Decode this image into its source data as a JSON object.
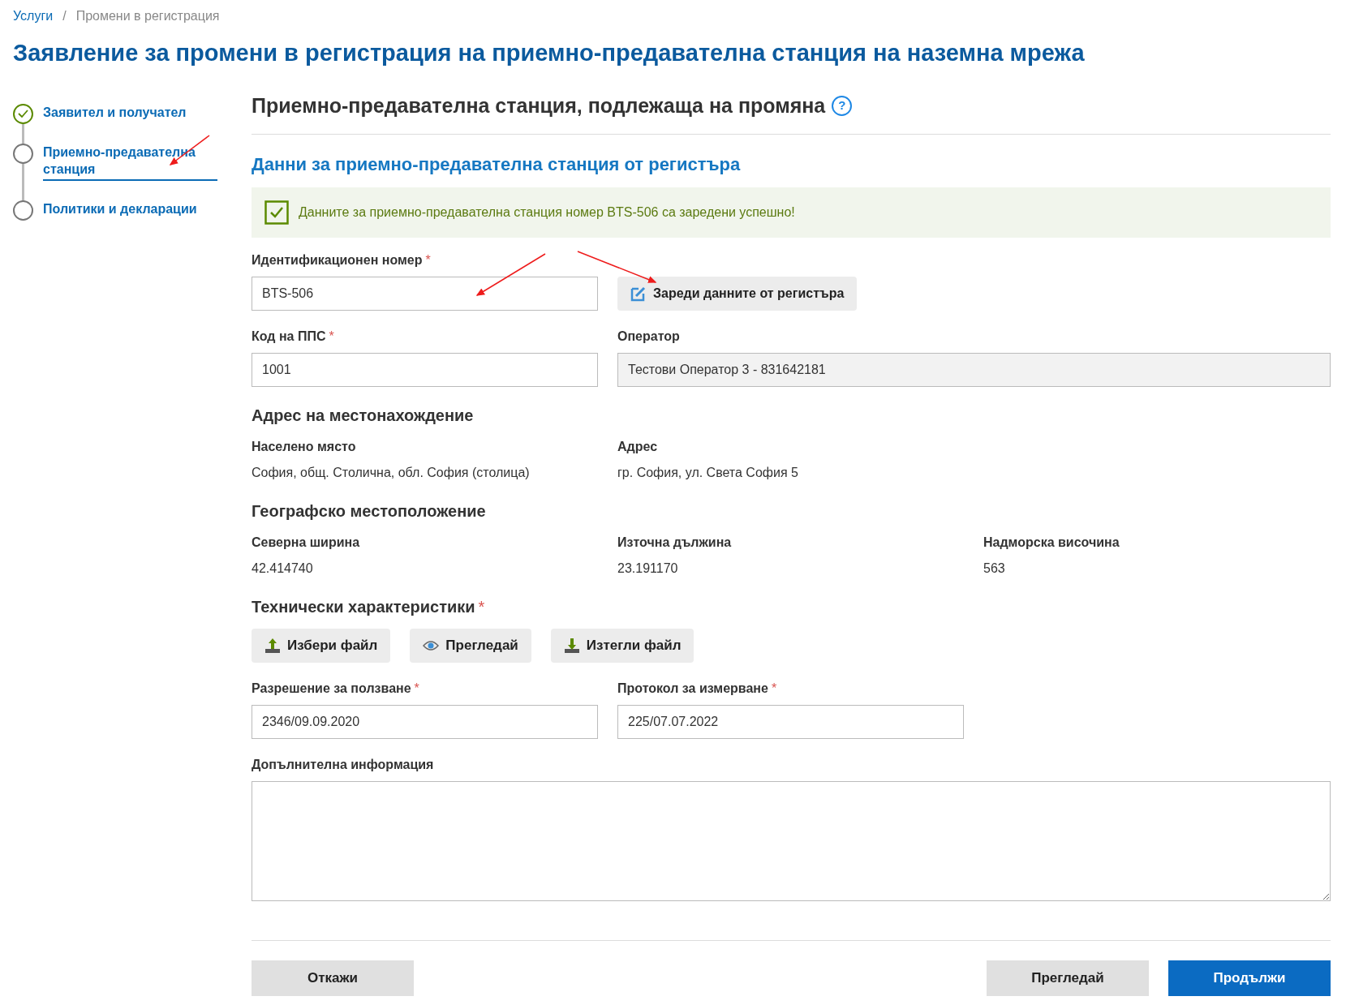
{
  "breadcrumb": [
    {
      "label": "Услуги",
      "kind": "link"
    },
    {
      "label": "/",
      "kind": "separator"
    },
    {
      "label": "Промени в регистрация",
      "kind": "current"
    }
  ],
  "help_icon": "?",
  "title": "Заявление за промени в регистрация на приемно-предавателна станция на наземна мрежа",
  "steps": [
    {
      "label": "Заявител и получател",
      "completed": true,
      "selected": false
    },
    {
      "label": "Приемно-предавателна станция",
      "completed": false,
      "selected": true
    },
    {
      "label": "Политики и декларации",
      "completed": false,
      "selected": false
    }
  ],
  "section_title": "Приемно-предавателна станция, подлежаща на промяна",
  "subsection_title": "Данни за приемно-предавателна станция от регистъра",
  "alert": "Данните за приемно-предавателна станция номер BTS-506 са заредени успешно!",
  "id_field": {
    "label": "Идентификационен номер",
    "required": "*",
    "value": "BTS-506"
  },
  "load_button": "Зареди данните от регистъра",
  "pps_field": {
    "label": "Код на ППС",
    "required": "*",
    "value": "1001"
  },
  "operator_field": {
    "label": "Оператор",
    "value": "Тестови Оператор 3 - 831642181",
    "disabled": true
  },
  "address": {
    "title": "Адрес на местонахождение",
    "items": [
      {
        "label": "Населено място",
        "value": "София, общ. Столична, обл. София (столица)"
      },
      {
        "label": "Адрес",
        "value": "гр. София, ул. Света София 5"
      }
    ]
  },
  "geo": {
    "title": "Географско местоположение",
    "items": [
      {
        "label": "Северна ширина",
        "value": "42.414740"
      },
      {
        "label": "Източна дължина",
        "value": "23.191170"
      },
      {
        "label": "Надморска височина",
        "value": "563"
      }
    ]
  },
  "tech": {
    "title": "Технически характеристики",
    "required": "*",
    "buttons": [
      {
        "kind": "upload",
        "label": "Избери файл"
      },
      {
        "kind": "view",
        "label": "Прегледай"
      },
      {
        "kind": "download",
        "label": "Изтегли файл"
      }
    ]
  },
  "permit_field": {
    "label": "Разрешение за ползване",
    "required": "*",
    "value": "2346/09.09.2020"
  },
  "protocol_field": {
    "label": "Протокол за измерване",
    "required": "*",
    "value": "225/07.07.2022"
  },
  "info_field": {
    "label": "Допълнителна информация"
  },
  "footer": {
    "cancel": "Откажи",
    "preview": "Прегледай",
    "continue": "Продължи"
  }
}
